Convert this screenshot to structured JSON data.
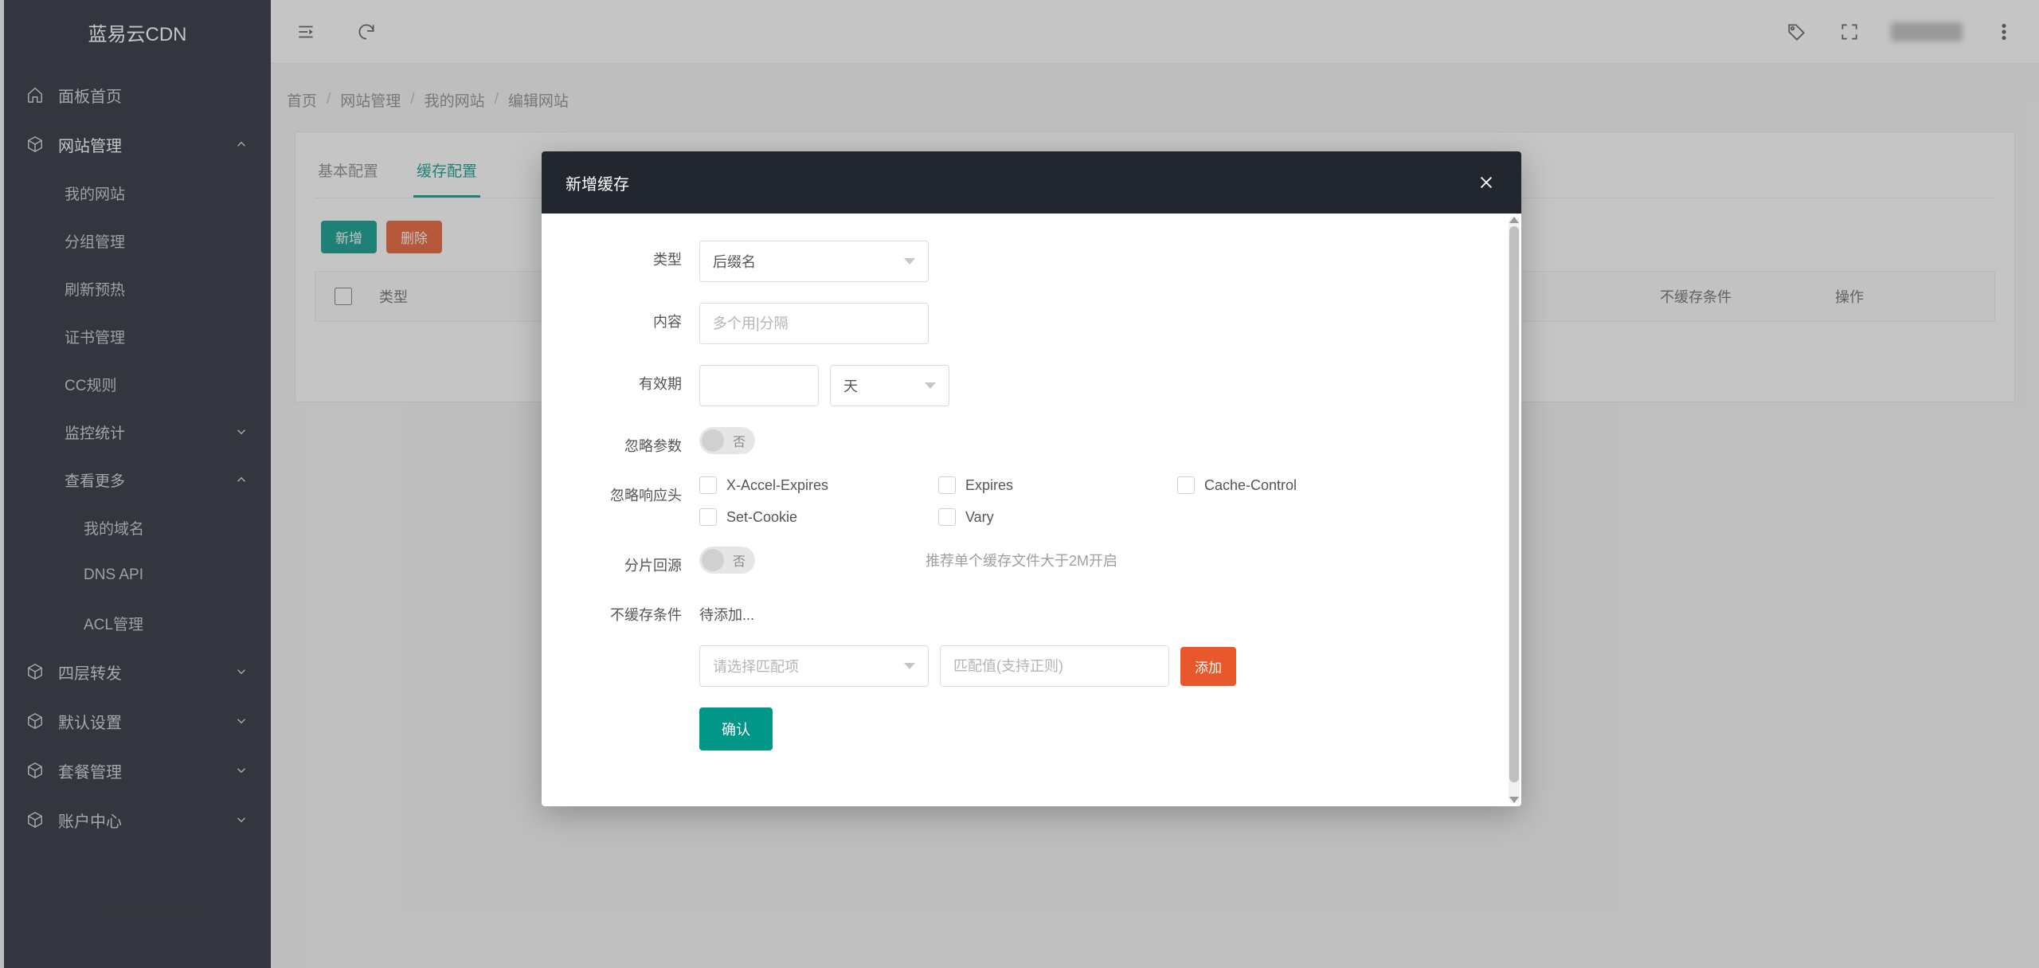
{
  "brand": "蓝易云CDN",
  "sidebar": {
    "panel_home": "面板首页",
    "site_manage": "网站管理",
    "site_sub": {
      "my_sites": "我的网站",
      "group_manage": "分组管理",
      "refresh_preheat": "刷新预热",
      "cert_manage": "证书管理",
      "cc_rules": "CC规则",
      "monitor_stats": "监控统计",
      "view_more": "查看更多",
      "my_domains": "我的域名",
      "dns_api": "DNS API",
      "acl_manage": "ACL管理"
    },
    "l4_forward": "四层转发",
    "default_settings": "默认设置",
    "package_manage": "套餐管理",
    "account_center": "账户中心"
  },
  "breadcrumb": {
    "home": "首页",
    "site_manage": "网站管理",
    "my_sites": "我的网站",
    "edit_site": "编辑网站"
  },
  "tabs": {
    "basic": "基本配置",
    "cache": "缓存配置"
  },
  "toolbar": {
    "add": "新增",
    "delete": "删除"
  },
  "table": {
    "col_type": "类型",
    "col_nocache": "不缓存条件",
    "col_op": "操作"
  },
  "modal": {
    "title": "新增缓存",
    "labels": {
      "type": "类型",
      "content": "内容",
      "validity": "有效期",
      "ignore_params": "忽略参数",
      "ignore_headers": "忽略响应头",
      "slice_origin": "分片回源",
      "nocache_cond": "不缓存条件"
    },
    "type_select": "后缀名",
    "content_placeholder": "多个用|分隔",
    "unit_select": "天",
    "switch_off": "否",
    "headers": [
      "X-Accel-Expires",
      "Expires",
      "Cache-Control",
      "Set-Cookie",
      "Vary"
    ],
    "slice_hint": "推荐单个缓存文件大于2M开启",
    "nocache_pending": "待添加...",
    "match_select_placeholder": "请选择匹配项",
    "match_value_placeholder": "匹配值(支持正则)",
    "add_btn": "添加",
    "confirm_btn": "确认"
  }
}
